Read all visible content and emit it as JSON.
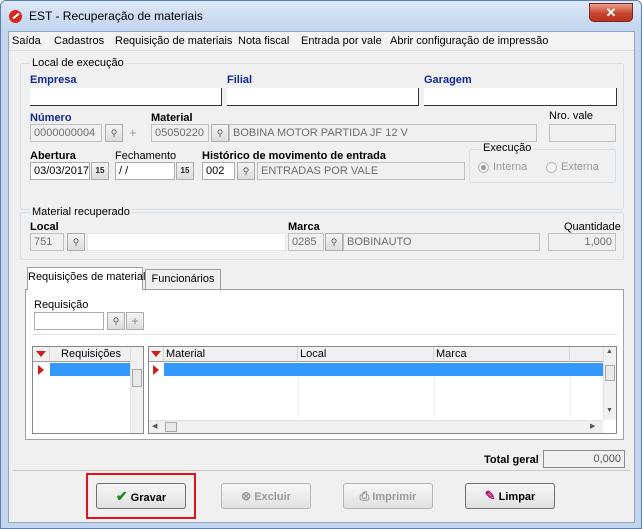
{
  "window": {
    "title": "EST - Recuperação de materiais"
  },
  "menu": [
    "Saída",
    "Cadastros",
    "Requisição de materiais",
    "Nota fiscal",
    "Entrada por vale",
    "Abrir configuração de impressão"
  ],
  "local_execucao": {
    "group_label": "Local de execução",
    "empresa_label": "Empresa",
    "empresa_value": "",
    "filial_label": "Filial",
    "filial_value": "",
    "garagem_label": "Garagem",
    "garagem_value": "",
    "numero_label": "Número",
    "numero_value": "0000000004",
    "material_label": "Material",
    "material_code": "05050220",
    "material_desc": "BOBINA MOTOR PARTIDA JF 12 V",
    "nro_vale_label": "Nro. vale",
    "nro_vale_value": "",
    "abertura_label": "Abertura",
    "abertura_value": "03/03/2017",
    "fechamento_label": "Fechamento",
    "fechamento_value": " / /",
    "historico_label": "Histórico de movimento de entrada",
    "historico_code": "002",
    "historico_desc": "ENTRADAS POR VALE",
    "execucao_label": "Execução",
    "execucao_options": [
      "Interna",
      "Externa"
    ],
    "execucao_selected": "Interna"
  },
  "material_recuperado": {
    "group_label": "Material recuperado",
    "local_label": "Local",
    "local_code": "751",
    "local_desc": "",
    "marca_label": "Marca",
    "marca_code": "0285",
    "marca_desc": "BOBINAUTO",
    "quantidade_label": "Quantidade",
    "quantidade_value": "1,000"
  },
  "tabs": [
    "Requisições de material",
    "Funcionários"
  ],
  "requisicao": {
    "label": "Requisição",
    "value": ""
  },
  "grid_requisicoes": {
    "headers": [
      "Requisições"
    ]
  },
  "grid_materiais": {
    "headers": [
      "Material",
      "Local",
      "Marca"
    ]
  },
  "total": {
    "label": "Total geral",
    "value": "0,000"
  },
  "buttons": {
    "gravar": "Gravar",
    "excluir": "Excluir",
    "imprimir": "Imprimir",
    "limpar": "Limpar"
  },
  "colors": {
    "highlight": "#e0121a",
    "grid_selection": "#3399ff",
    "label_blue": "#102a9a"
  }
}
